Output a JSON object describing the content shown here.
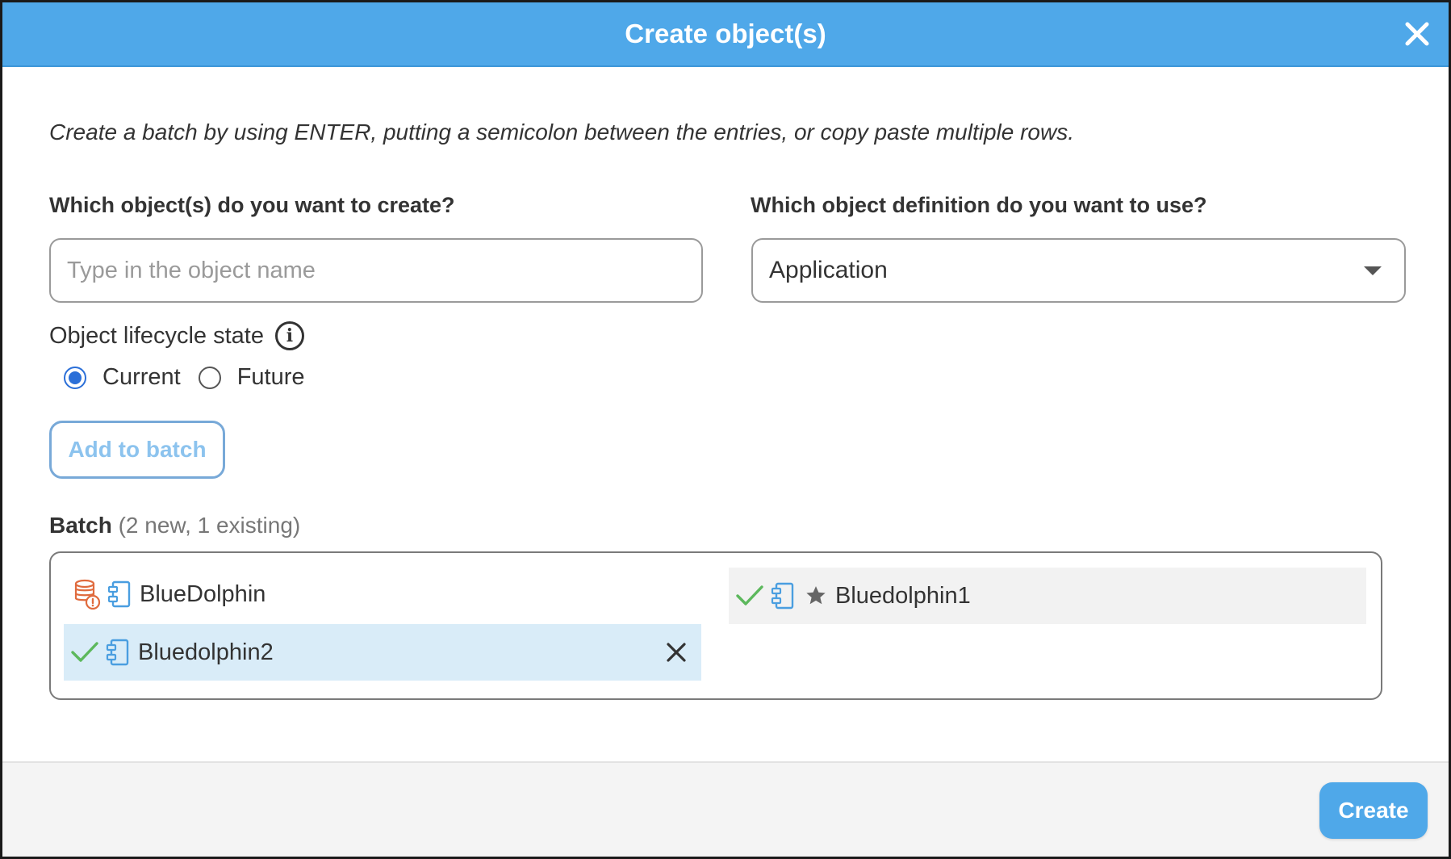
{
  "dialog": {
    "title": "Create object(s)",
    "instructions": "Create a batch by using ENTER, putting a semicolon between the entries, or copy paste multiple rows."
  },
  "form": {
    "objects_label": "Which object(s) do you want to create?",
    "objects_placeholder": "Type in the object name",
    "definition_label": "Which object definition do you want to use?",
    "definition_value": "Application",
    "lifecycle_label": "Object lifecycle state",
    "lifecycle_options": [
      {
        "label": "Current",
        "checked": true
      },
      {
        "label": "Future",
        "checked": false
      }
    ],
    "add_button": "Add to batch"
  },
  "batch": {
    "label": "Batch",
    "count": "(2 new, 1 existing)",
    "items": [
      {
        "name": "BlueDolphin",
        "status": "existing-warning",
        "icon": "database-warning-icon"
      },
      {
        "name": "Bluedolphin1",
        "status": "new",
        "icon": "check-icon",
        "starred": true
      },
      {
        "name": "Bluedolphin2",
        "status": "new",
        "icon": "check-icon",
        "selected": true
      }
    ]
  },
  "footer": {
    "create_button": "Create"
  },
  "colors": {
    "header": "#4fa8e9",
    "primary_button": "#4fa8e9",
    "radio_selected": "#2b6fd8",
    "check": "#5cb85c",
    "warning": "#e06b3e",
    "component_icon": "#4a9ee0",
    "selected_row": "#d9ecf8"
  }
}
